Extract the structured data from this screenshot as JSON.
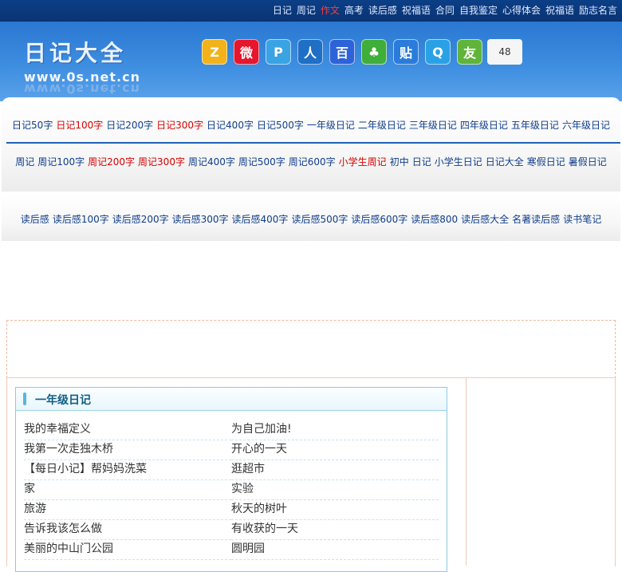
{
  "topnav": [
    {
      "label": "日记",
      "hl": false
    },
    {
      "label": "周记",
      "hl": false
    },
    {
      "label": "作文",
      "hl": true
    },
    {
      "label": "高考",
      "hl": false
    },
    {
      "label": "读后感",
      "hl": false
    },
    {
      "label": "祝福语",
      "hl": false
    },
    {
      "label": "合同",
      "hl": false
    },
    {
      "label": "自我鉴定",
      "hl": false
    },
    {
      "label": "心得体会",
      "hl": false
    },
    {
      "label": "祝福语",
      "hl": false
    },
    {
      "label": "励志名言",
      "hl": false
    }
  ],
  "logo": {
    "title": "日记大全",
    "url": "www.0s.net.cn"
  },
  "share": {
    "icons": [
      {
        "name": "qzone-icon",
        "glyph": "Z",
        "color": "#f2b21a"
      },
      {
        "name": "weibo-icon",
        "glyph": "微",
        "color": "#e6162d"
      },
      {
        "name": "tqq-icon",
        "glyph": "P",
        "color": "#3aa3e3"
      },
      {
        "name": "renren-icon",
        "glyph": "人",
        "color": "#1f6fc6"
      },
      {
        "name": "baidu-icon",
        "glyph": "百",
        "color": "#2e62d9"
      },
      {
        "name": "kaixin-icon",
        "glyph": "♣",
        "color": "#3fae3a"
      },
      {
        "name": "tieba-icon",
        "glyph": "贴",
        "color": "#2a7cdb"
      },
      {
        "name": "tencent-icon",
        "glyph": "Q",
        "color": "#2aa1e4"
      },
      {
        "name": "pengyou-icon",
        "glyph": "友",
        "color": "#60b43a"
      }
    ],
    "count": "48"
  },
  "nav_row1": [
    {
      "label": "日记50字",
      "r": false
    },
    {
      "label": "日记100字",
      "r": true
    },
    {
      "label": "日记200字",
      "r": false
    },
    {
      "label": "日记300字",
      "r": true
    },
    {
      "label": "日记400字",
      "r": false
    },
    {
      "label": "日记500字",
      "r": false
    },
    {
      "label": "一年级日记",
      "r": false
    },
    {
      "label": "二年级日记",
      "r": false
    },
    {
      "label": "三年级日记",
      "r": false
    },
    {
      "label": "四年级日记",
      "r": false
    },
    {
      "label": "五年级日记",
      "r": false
    },
    {
      "label": "六年级日记",
      "r": false
    }
  ],
  "nav_row2": [
    {
      "label": "周记",
      "r": false
    },
    {
      "label": "周记100字",
      "r": false
    },
    {
      "label": "周记200字",
      "r": true
    },
    {
      "label": "周记300字",
      "r": true
    },
    {
      "label": "周记400字",
      "r": false
    },
    {
      "label": "周记500字",
      "r": false
    },
    {
      "label": "周记600字",
      "r": false
    },
    {
      "label": "小学生周记",
      "r": true
    },
    {
      "label": "初中",
      "r": false
    },
    {
      "label": "日记",
      "r": false
    },
    {
      "label": "小学生日记",
      "r": false
    },
    {
      "label": "日记大全",
      "r": false
    },
    {
      "label": "寒假日记",
      "r": false
    },
    {
      "label": "暑假日记",
      "r": false
    }
  ],
  "nav_row3": [
    {
      "label": "读后感",
      "r": false
    },
    {
      "label": "读后感100字",
      "r": false
    },
    {
      "label": "读后感200字",
      "r": false
    },
    {
      "label": "读后感300字",
      "r": false
    },
    {
      "label": "读后感400字",
      "r": false
    },
    {
      "label": "读后感500字",
      "r": false
    },
    {
      "label": "读后感600字",
      "r": false
    },
    {
      "label": "读后感800",
      "r": false
    },
    {
      "label": "读后感大全",
      "r": false
    },
    {
      "label": "名著读后感",
      "r": false
    },
    {
      "label": "读书笔记",
      "r": false
    }
  ],
  "section": {
    "title": "一年级日记",
    "items": [
      "我的幸福定义",
      "为自己加油!",
      "我第一次走独木桥",
      "开心的一天",
      "【每日小记】帮妈妈洗菜",
      "逛超市",
      "家",
      "实验",
      "旅游",
      "秋天的树叶",
      "告诉我该怎么做",
      "有收获的一天",
      "美丽的中山门公园",
      "圆明园"
    ]
  }
}
